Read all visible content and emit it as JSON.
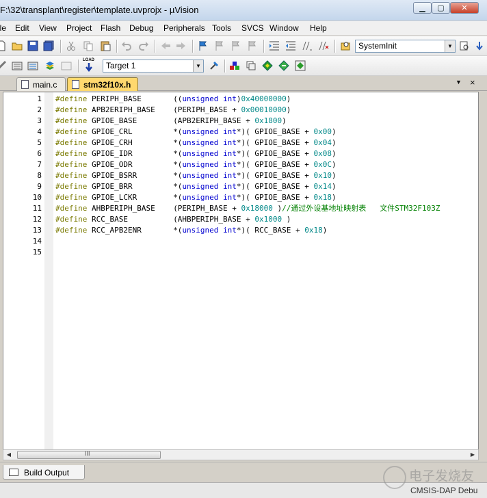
{
  "window": {
    "title": "F:\\32\\transplant\\register\\template.uvprojx - µVision",
    "minimize": "▁",
    "maximize": "▢",
    "close": "✕"
  },
  "menu": [
    "ile",
    "Edit",
    "View",
    "Project",
    "Flash",
    "Debug",
    "Peripherals",
    "Tools",
    "SVCS",
    "Window",
    "Help"
  ],
  "toolbar": {
    "function_combo": "SystemInit",
    "target_combo": "Target 1",
    "load_label": "LOAD",
    "combo_arrow": "▼"
  },
  "tabs": [
    {
      "label": "main.c",
      "active": false
    },
    {
      "label": "stm32f10x.h",
      "active": true
    }
  ],
  "tab_controls": {
    "dropdown": "▼",
    "close": "×"
  },
  "code": [
    {
      "n": "1",
      "parts": [
        [
          "d",
          "#define"
        ],
        [
          "t",
          " PERIPH_BASE       (("
        ],
        [
          "k",
          "unsigned int"
        ],
        [
          "t",
          ")"
        ],
        [
          "n",
          "0x40000000"
        ],
        [
          "t",
          ")"
        ]
      ]
    },
    {
      "n": "2",
      "parts": [
        [
          "d",
          "#define"
        ],
        [
          "t",
          " APB2ERIPH_BASE    (PERIPH_BASE + "
        ],
        [
          "n",
          "0x00010000"
        ],
        [
          "t",
          ")"
        ]
      ]
    },
    {
      "n": "3",
      "parts": [
        [
          "d",
          "#define"
        ],
        [
          "t",
          " GPIOE_BASE        (APB2ERIPH_BASE + "
        ],
        [
          "n",
          "0x1800"
        ],
        [
          "t",
          ")"
        ]
      ]
    },
    {
      "n": "4",
      "parts": [
        [
          "d",
          "#define"
        ],
        [
          "t",
          " GPIOE_CRL         *("
        ],
        [
          "k",
          "unsigned int"
        ],
        [
          "t",
          "*)( GPIOE_BASE + "
        ],
        [
          "n",
          "0x00"
        ],
        [
          "t",
          ")"
        ]
      ]
    },
    {
      "n": "5",
      "parts": [
        [
          "d",
          "#define"
        ],
        [
          "t",
          " GPIOE_CRH         *("
        ],
        [
          "k",
          "unsigned int"
        ],
        [
          "t",
          "*)( GPIOE_BASE + "
        ],
        [
          "n",
          "0x04"
        ],
        [
          "t",
          ")"
        ]
      ]
    },
    {
      "n": "6",
      "parts": [
        [
          "d",
          "#define"
        ],
        [
          "t",
          " GPIOE_IDR         *("
        ],
        [
          "k",
          "unsigned int"
        ],
        [
          "t",
          "*)( GPIOE_BASE + "
        ],
        [
          "n",
          "0x08"
        ],
        [
          "t",
          ")"
        ]
      ]
    },
    {
      "n": "7",
      "parts": [
        [
          "d",
          "#define"
        ],
        [
          "t",
          " GPIOE_ODR         *("
        ],
        [
          "k",
          "unsigned int"
        ],
        [
          "t",
          "*)( GPIOE_BASE + "
        ],
        [
          "n",
          "0x0C"
        ],
        [
          "t",
          ")"
        ]
      ]
    },
    {
      "n": "8",
      "parts": [
        [
          "d",
          "#define"
        ],
        [
          "t",
          " GPIOE_BSRR        *("
        ],
        [
          "k",
          "unsigned int"
        ],
        [
          "t",
          "*)( GPIOE_BASE + "
        ],
        [
          "n",
          "0x10"
        ],
        [
          "t",
          ")"
        ]
      ]
    },
    {
      "n": "9",
      "parts": [
        [
          "d",
          "#define"
        ],
        [
          "t",
          " GPIOE_BRR         *("
        ],
        [
          "k",
          "unsigned int"
        ],
        [
          "t",
          "*)( GPIOE_BASE + "
        ],
        [
          "n",
          "0x14"
        ],
        [
          "t",
          ")"
        ]
      ]
    },
    {
      "n": "10",
      "parts": [
        [
          "d",
          "#define"
        ],
        [
          "t",
          " GPIOE_LCKR        *("
        ],
        [
          "k",
          "unsigned int"
        ],
        [
          "t",
          "*)( GPIOE_BASE + "
        ],
        [
          "n",
          "0x18"
        ],
        [
          "t",
          ")"
        ]
      ]
    },
    {
      "n": "11",
      "parts": [
        [
          "d",
          "#define"
        ],
        [
          "t",
          " AHBPERIPH_BASE    (PERIPH_BASE + "
        ],
        [
          "n",
          "0x18000"
        ],
        [
          "t",
          " )"
        ],
        [
          "c",
          "//通过外设基地址映射表   文件STM32F103Z"
        ]
      ]
    },
    {
      "n": "12",
      "parts": [
        [
          "d",
          "#define"
        ],
        [
          "t",
          " RCC_BASE          (AHBPERIPH_BASE + "
        ],
        [
          "n",
          "0x1000"
        ],
        [
          "t",
          " )"
        ]
      ]
    },
    {
      "n": "13",
      "parts": [
        [
          "d",
          "#define"
        ],
        [
          "t",
          " RCC_APB2ENR       *("
        ],
        [
          "k",
          "unsigned int"
        ],
        [
          "t",
          "*)( RCC_BASE + "
        ],
        [
          "n",
          "0x18"
        ],
        [
          "t",
          ")"
        ]
      ]
    },
    {
      "n": "14",
      "parts": []
    },
    {
      "n": "15",
      "parts": []
    }
  ],
  "scrollbar": {
    "left": "◀",
    "right": "▶",
    "grip": "III"
  },
  "output_tab": {
    "label": "Build Output"
  },
  "status": {
    "text": "CMSIS-DAP Debu"
  },
  "watermark": {
    "text": "电子发烧友"
  },
  "colors": {
    "define": "#7a7a00",
    "keyword": "#0000d0",
    "number": "#008888",
    "comment": "#008000",
    "active_tab": "#ffd86e"
  }
}
